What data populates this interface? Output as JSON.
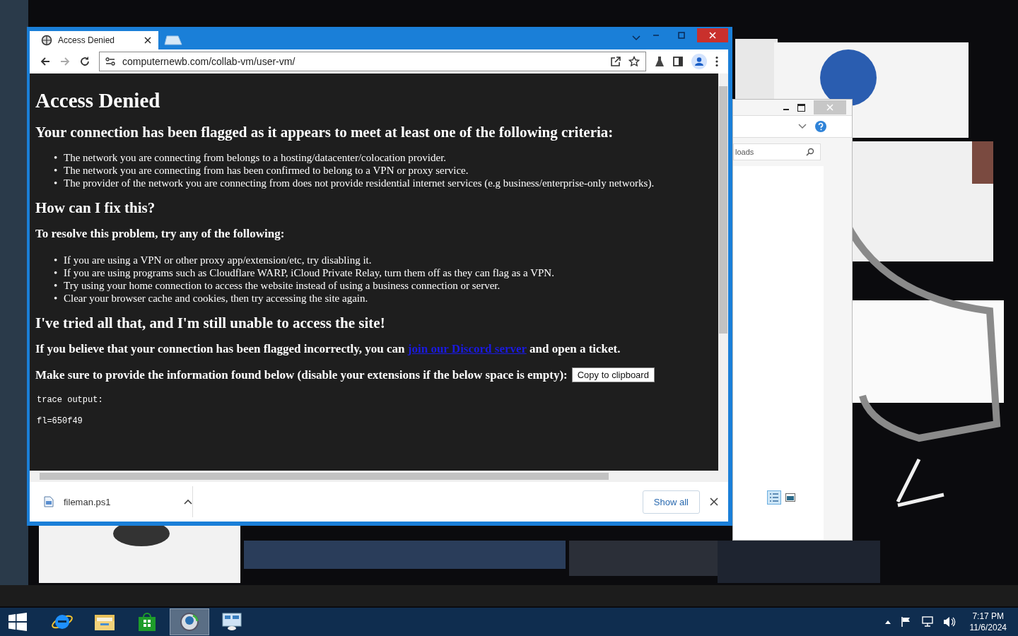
{
  "browser": {
    "tab": {
      "title": "Access Denied"
    },
    "url": "computernewb.com/collab-vm/user-vm/",
    "page": {
      "bullet": "•",
      "title": "Access Denied",
      "heading": "Your connection has been flagged as it appears to meet at least one of the following criteria:",
      "criteria": [
        "The network you are connecting from belongs to a hosting/datacenter/colocation provider.",
        "The network you are connecting from has been confirmed to belong to a VPN or proxy service.",
        "The provider of the network you are connecting from does not provide residential internet services (e.g business/enterprise-only networks)."
      ],
      "fix_heading": "How can I fix this?",
      "fix_intro": "To resolve this problem, try any of the following:",
      "fixes": [
        "If you are using a VPN or other proxy app/extension/etc, try disabling it.",
        "If you are using programs such as Cloudflare WARP, iCloud Private Relay, turn them off as they can flag as a VPN.",
        "Try using your home connection to access the website instead of using a business connection or server.",
        "Clear your browser cache and cookies, then try accessing the site again."
      ],
      "still_heading": "I've tried all that, and I'm still unable to access the site!",
      "ticket": {
        "before": "If you believe that your connection has been flagged incorrectly, you can",
        "link": "join our Discord server",
        "after": "and open a ticket."
      },
      "provide": "Make sure to provide the information found below (disable your extensions if the below space is empty):",
      "copy_button": "Copy to clipboard",
      "trace": [
        "trace output:",
        "fl=650f49"
      ]
    },
    "download": {
      "file": "fileman.ps1",
      "show_all": "Show all"
    }
  },
  "explorer": {
    "search_value": "loads"
  },
  "taskbar": {
    "apps": [
      {
        "kind": "ie",
        "selected": false
      },
      {
        "kind": "folder",
        "selected": false
      },
      {
        "kind": "store",
        "selected": false
      },
      {
        "kind": "globe",
        "selected": true
      },
      {
        "kind": "panel",
        "selected": false
      }
    ],
    "time": "7:17 PM",
    "date": "11/6/2024"
  }
}
